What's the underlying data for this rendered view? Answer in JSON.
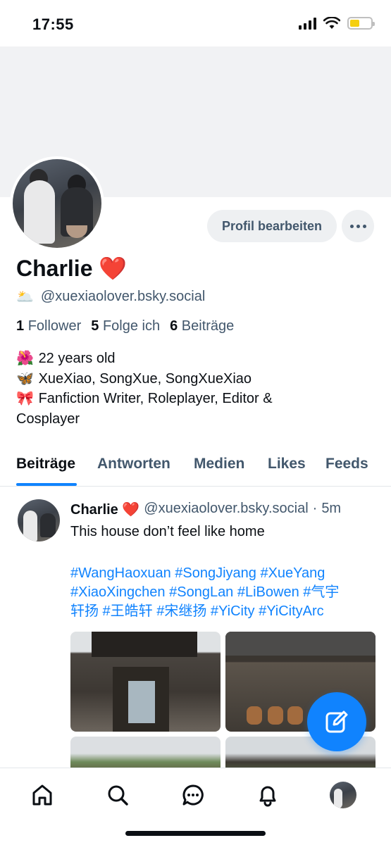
{
  "status_bar": {
    "time": "17:55"
  },
  "profile": {
    "edit_button": "Profil bearbeiten",
    "display_name": "Charlie ❤️",
    "handle_emoji": "🌥️",
    "handle": "@xuexiaolover.bsky.social",
    "stats": {
      "followers_count": "1",
      "followers_label": "Follower",
      "following_count": "5",
      "following_label": "Folge ich",
      "posts_count": "6",
      "posts_label": "Beiträge"
    },
    "bio": [
      {
        "emoji": "🌺",
        "text": "22 years old"
      },
      {
        "emoji": "🦋",
        "text": "XueXiao, SongXue, SongXueXiao"
      },
      {
        "emoji": "🎀",
        "text": "Fanfiction Writer, Roleplayer, Editor &"
      },
      {
        "emoji": "",
        "text": "Cosplayer"
      }
    ]
  },
  "tabs": [
    {
      "label": "Beiträge",
      "active": true
    },
    {
      "label": "Antworten",
      "active": false
    },
    {
      "label": "Medien",
      "active": false
    },
    {
      "label": "Likes",
      "active": false
    },
    {
      "label": "Feeds",
      "active": false
    }
  ],
  "post": {
    "author": "Charlie ❤️",
    "handle": "@xuexiaolover.bsky.social",
    "separator": "·",
    "time": "5m",
    "text": "This house don’t feel like home",
    "tags_line1": "#WangHaoxuan #SongJiyang #XueYang",
    "tags_line2": "#XiaoXingchen #SongLan #LiBowen #气宇",
    "tags_line3": "轩扬 #王皓轩 #宋继扬 #YiCity #YiCityArc"
  },
  "colors": {
    "accent": "#1083fe",
    "secondary_text": "#42576c",
    "button_bg": "#eef0f2",
    "banner": "#f1f2f4"
  },
  "icons": {
    "nav": [
      "home-icon",
      "search-icon",
      "chat-icon",
      "bell-icon",
      "profile-avatar"
    ],
    "fab": "compose-icon",
    "more": "ellipsis-icon"
  }
}
